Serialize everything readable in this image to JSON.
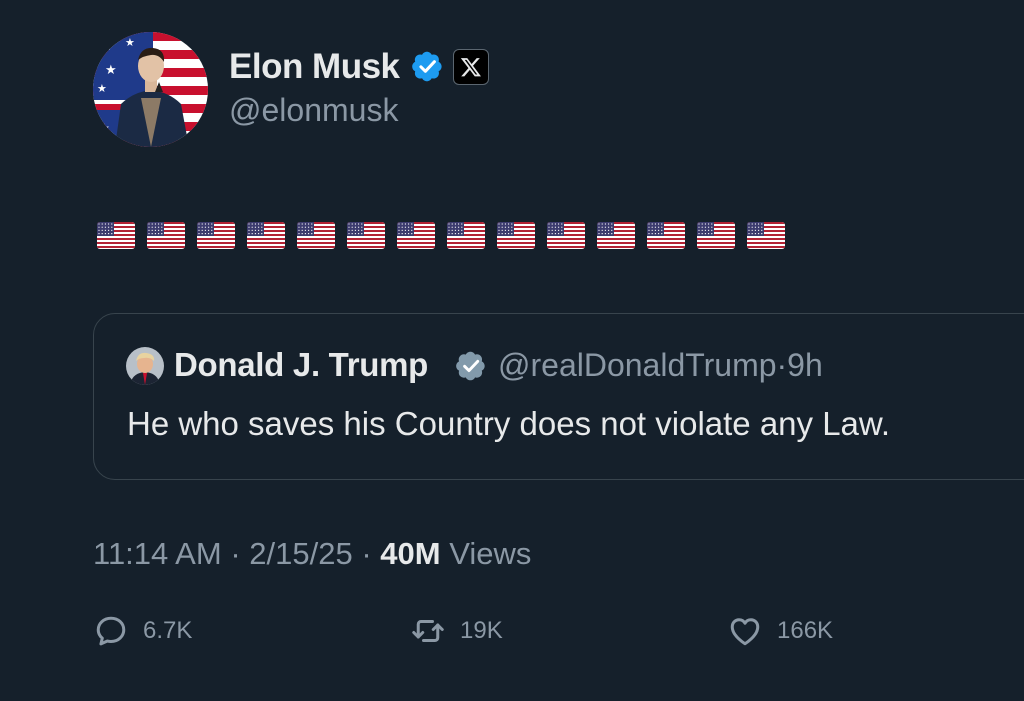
{
  "author": {
    "display_name": "Elon Musk",
    "handle": "@elonmusk",
    "verified": true,
    "affiliation_badge": "x-logo-icon"
  },
  "tweet": {
    "text": "🇺🇸🇺🇸🇺🇸🇺🇸🇺🇸🇺🇸🇺🇸🇺🇸🇺🇸🇺🇸🇺🇸🇺🇸🇺🇸🇺🇸",
    "flag_count": 14
  },
  "quoted": {
    "display_name": "Donald J. Trump",
    "handle": "@realDonaldTrump",
    "separator": "·",
    "age": "9h",
    "text": "He who saves his Country does not violate any Law.",
    "verified": true
  },
  "meta": {
    "time": "11:14 AM",
    "sep1": "·",
    "date": "2/15/25",
    "sep2": "·",
    "views_count": "40M",
    "views_label": "Views"
  },
  "actions": {
    "replies": "6.7K",
    "reposts": "19K",
    "likes": "166K"
  },
  "colors": {
    "background": "#15202b",
    "text_primary": "#e7e9ea",
    "text_secondary": "#8b98a5",
    "verified": "#1d9bf0",
    "border": "#38444d"
  }
}
